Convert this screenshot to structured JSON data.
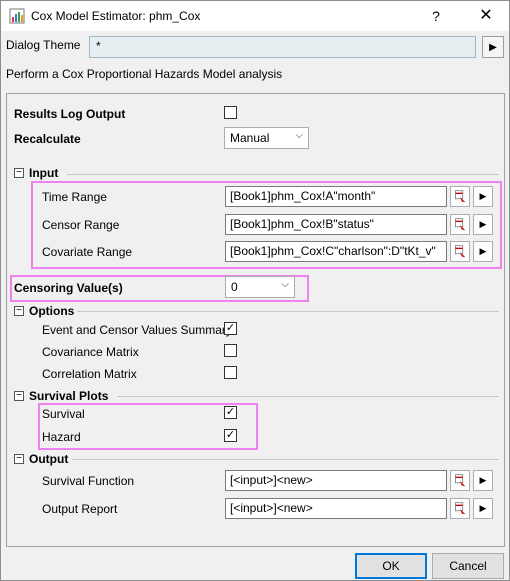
{
  "window": {
    "title": "Cox Model Estimator: phm_Cox",
    "help_label": "?",
    "close_label": "✕"
  },
  "theme": {
    "label": "Dialog Theme",
    "value": "*",
    "arrow": "▶"
  },
  "description": "Perform a Cox Proportional Hazards Model analysis",
  "general": {
    "results_log_output": {
      "label": "Results Log Output",
      "checked": false
    },
    "recalculate": {
      "label": "Recalculate",
      "value": "Manual"
    }
  },
  "input": {
    "header": "Input",
    "toggle": "−",
    "time_range": {
      "label": "Time Range",
      "value": "[Book1]phm_Cox!A\"month\""
    },
    "censor_range": {
      "label": "Censor Range",
      "value": "[Book1]phm_Cox!B\"status\""
    },
    "covariate_range": {
      "label": "Covariate Range",
      "value": "[Book1]phm_Cox!C\"charlson\":D\"tKt_v\""
    }
  },
  "censoring_value": {
    "label": "Censoring Value(s)",
    "value": "0"
  },
  "options": {
    "header": "Options",
    "toggle": "−",
    "event_censor_summary": {
      "label": "Event and Censor Values Summary",
      "checked": true
    },
    "covariance_matrix": {
      "label": "Covariance Matrix",
      "checked": false
    },
    "correlation_matrix": {
      "label": "Correlation Matrix",
      "checked": false
    }
  },
  "survival_plots": {
    "header": "Survival Plots",
    "toggle": "−",
    "survival": {
      "label": "Survival",
      "checked": true
    },
    "hazard": {
      "label": "Hazard",
      "checked": true
    }
  },
  "output": {
    "header": "Output",
    "toggle": "−",
    "survival_function": {
      "label": "Survival Function",
      "value": "[<input>]<new>"
    },
    "output_report": {
      "label": "Output Report",
      "value": "[<input>]<new>"
    }
  },
  "buttons": {
    "ok": "OK",
    "cancel": "Cancel"
  },
  "colors": {
    "highlight": "#ee82ee",
    "accent": "#0078d7"
  },
  "checkmark": "✓",
  "chevron": "⌵"
}
